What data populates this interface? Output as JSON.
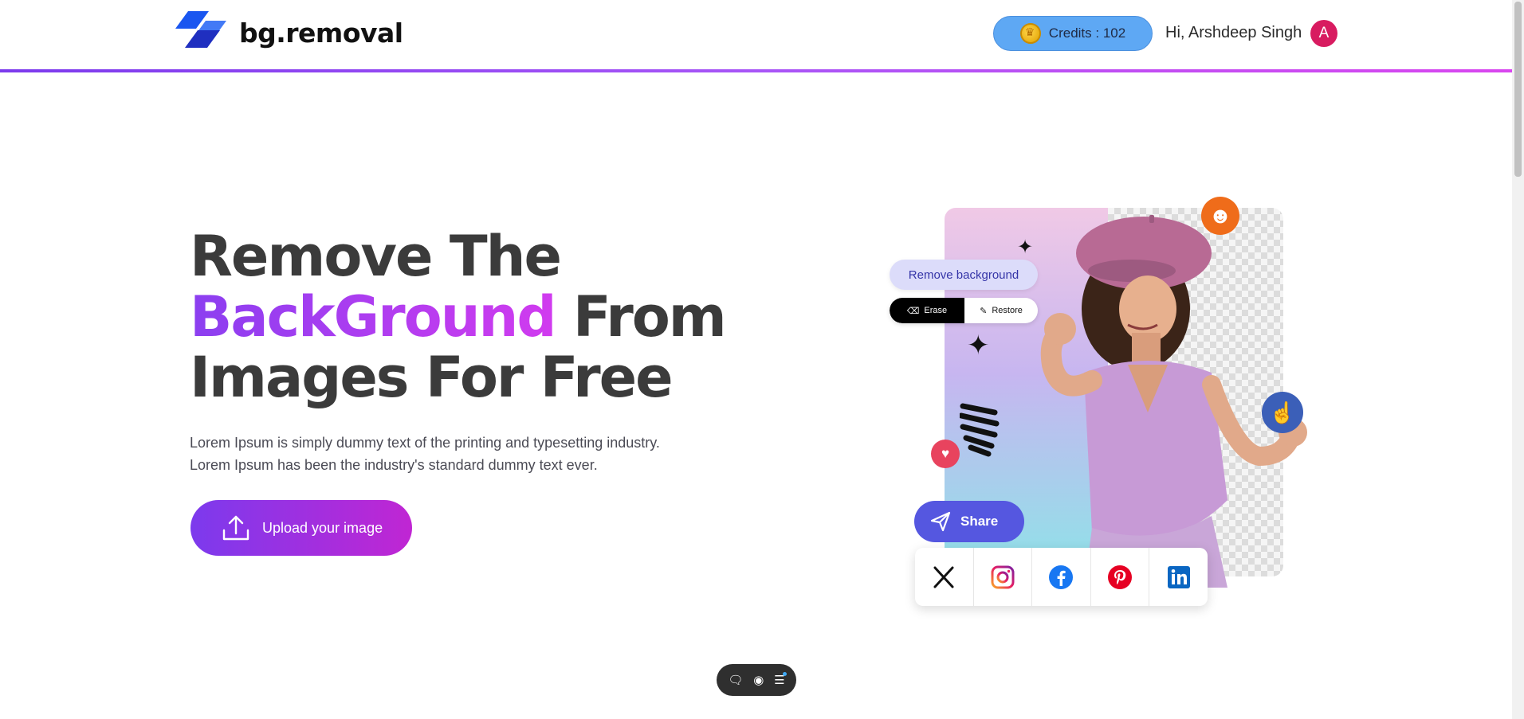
{
  "header": {
    "brand": "bg.removal",
    "credits_label": "Credits : 102",
    "greeting": "Hi, Arshdeep Singh",
    "avatar_initial": "A"
  },
  "hero": {
    "title_line1": "Remove The",
    "title_highlight": "BackGround",
    "title_line2_rest": " From",
    "title_line3": "Images For Free",
    "description_line1": "Lorem Ipsum is simply dummy text of the printing and typesetting industry.",
    "description_line2": "Lorem Ipsum has been the industry's standard dummy text ever.",
    "upload_label": "Upload your image"
  },
  "illustration": {
    "remove_bg_label": "Remove background",
    "erase_label": "Erase",
    "restore_label": "Restore",
    "share_label": "Share",
    "socials": [
      "x-icon",
      "instagram-icon",
      "facebook-icon",
      "pinterest-icon",
      "linkedin-icon"
    ]
  },
  "colors": {
    "accent_start": "#7c3aed",
    "accent_end": "#c026d3",
    "credits_bg": "#5ea8f4",
    "avatar_bg": "#d81b60",
    "share_bg": "#5557e0"
  },
  "floating_toolbar": {
    "icons": [
      "chat-icon",
      "toggle-icon",
      "menu-icon"
    ]
  }
}
